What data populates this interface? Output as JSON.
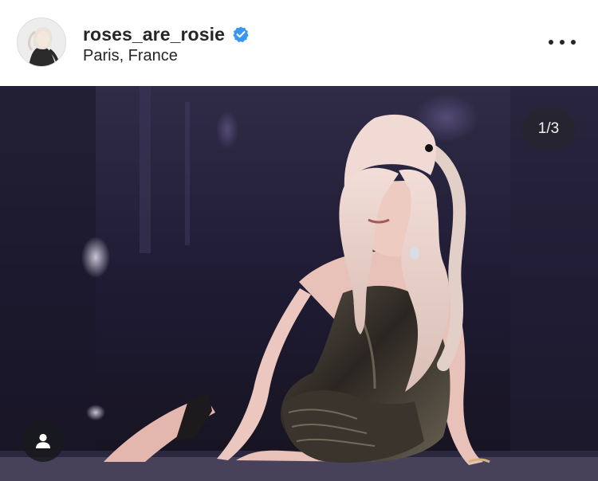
{
  "header": {
    "username": "roses_are_rosie",
    "verified": true,
    "location": "Paris, France"
  },
  "icons": {
    "verified": "verified-badge-icon",
    "more": "more-options-icon",
    "tag": "user-tag-icon"
  },
  "carousel": {
    "counter": "1/3",
    "current": 1,
    "total": 3
  },
  "colors": {
    "text": "#262626",
    "verified": "#3897f0",
    "photo_background": "#1d1a30"
  }
}
